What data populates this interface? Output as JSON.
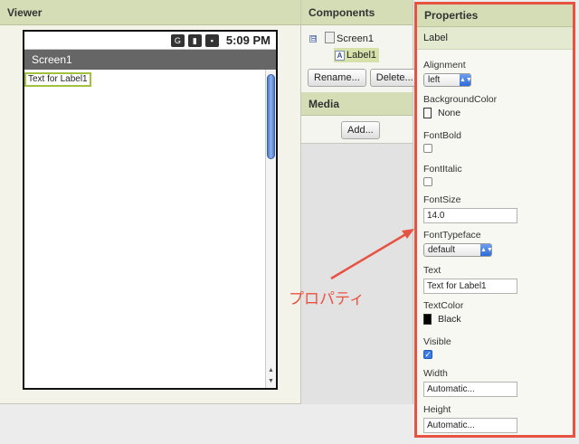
{
  "viewer": {
    "title": "Viewer",
    "phone": {
      "status_time": "5:09 PM",
      "status_icons": [
        "network-type-icon",
        "signal-icon",
        "battery-icon"
      ],
      "screen_title": "Screen1",
      "label_text": "Text for Label1"
    }
  },
  "components": {
    "title": "Components",
    "tree_toggle": "⊟",
    "screen_node": "Screen1",
    "label_node": "Label1",
    "rename_label": "Rename...",
    "delete_label": "Delete..."
  },
  "media": {
    "title": "Media",
    "add_label": "Add..."
  },
  "properties": {
    "title": "Properties",
    "component": "Label",
    "alignment": {
      "label": "Alignment",
      "value": "left"
    },
    "background_color": {
      "label": "BackgroundColor",
      "value": "None"
    },
    "font_bold": {
      "label": "FontBold",
      "checked": false
    },
    "font_italic": {
      "label": "FontItalic",
      "checked": false
    },
    "font_size": {
      "label": "FontSize",
      "value": "14.0"
    },
    "font_typeface": {
      "label": "FontTypeface",
      "value": "default"
    },
    "text": {
      "label": "Text",
      "value": "Text for Label1"
    },
    "text_color": {
      "label": "TextColor",
      "value": "Black"
    },
    "visible": {
      "label": "Visible",
      "checked": true
    },
    "width": {
      "label": "Width",
      "value": "Automatic..."
    },
    "height": {
      "label": "Height",
      "value": "Automatic..."
    }
  },
  "annotation": {
    "text": "プロパティ",
    "color": "#e85243"
  },
  "colors": {
    "header": "#d4ddb5",
    "selected": "#d5e1a8",
    "highlight_border": "#e85243",
    "label_outline": "#a2c13c"
  }
}
